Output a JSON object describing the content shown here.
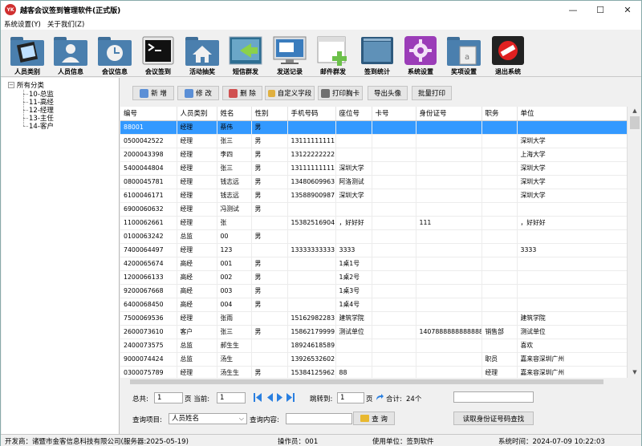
{
  "window": {
    "icon_text": "YK",
    "title": "越客会议签到管理软件(正式版)",
    "minimize": "—",
    "maximize": "☐",
    "close": "✕"
  },
  "menu": {
    "items": [
      "系统设置(Y)",
      "关于我们(Z)"
    ]
  },
  "toolbar": {
    "buttons": [
      "人员类别",
      "人员信息",
      "会议信息",
      "会议签到",
      "活动抽奖",
      "短信群发",
      "发送记录",
      "邮件群发",
      "签到统计",
      "系统设置",
      "奖项设置",
      "退出系统"
    ]
  },
  "tree": {
    "root": "所有分类",
    "children": [
      "10-总监",
      "11-高经",
      "12-经理",
      "13-主任",
      "14-客户"
    ]
  },
  "actions": {
    "add": "新 增",
    "edit": "修 改",
    "delete": "删 除",
    "custom_field": "自定义字段",
    "print_card": "打印胸卡",
    "export_avatar": "导出头像",
    "batch_print": "批量打印"
  },
  "table": {
    "columns": [
      "编号",
      "人员类别",
      "姓名",
      "性别",
      "手机号码",
      "座位号",
      "卡号",
      "身份证号",
      "职务",
      "单位"
    ],
    "rows": [
      [
        "88001",
        "经理",
        "蔡伟",
        "男",
        "",
        "",
        "",
        "",
        "",
        ""
      ],
      [
        "0500042522",
        "经理",
        "张三",
        "男",
        "13111111111",
        "",
        "",
        "",
        "",
        "深圳大学"
      ],
      [
        "2000043398",
        "经理",
        "李四",
        "男",
        "13122222222",
        "",
        "",
        "",
        "",
        "上海大学"
      ],
      [
        "5400044804",
        "经理",
        "张三",
        "男",
        "13111111111",
        "深圳大学",
        "",
        "",
        "",
        "深圳大学"
      ],
      [
        "0800045781",
        "经理",
        "钱志远",
        "男",
        "13480609963",
        "阿洛测试",
        "",
        "",
        "",
        "深圳大学"
      ],
      [
        "6100046171",
        "经理",
        "钱志远",
        "男",
        "13588900987",
        "深圳大学",
        "",
        "",
        "",
        "深圳大学"
      ],
      [
        "6900060632",
        "经理",
        "冯测试",
        "男",
        "",
        "",
        "",
        "",
        "",
        ""
      ],
      [
        "1100062661",
        "经理",
        "张",
        "",
        "15382516904",
        "，好好好",
        "",
        "111",
        "",
        "，好好好"
      ],
      [
        "0100063242",
        "总监",
        "00",
        "男",
        "",
        "",
        "",
        "",
        "",
        ""
      ],
      [
        "7400064497",
        "经理",
        "123",
        "",
        "13333333333",
        "3333",
        "",
        "",
        "",
        "3333"
      ],
      [
        "4200065674",
        "高经",
        "001",
        "男",
        "",
        "1桌1号",
        "",
        "",
        "",
        ""
      ],
      [
        "1200066133",
        "高经",
        "002",
        "男",
        "",
        "1桌2号",
        "",
        "",
        "",
        ""
      ],
      [
        "9200067668",
        "高经",
        "003",
        "男",
        "",
        "1桌3号",
        "",
        "",
        "",
        ""
      ],
      [
        "6400068450",
        "高经",
        "004",
        "男",
        "",
        "1桌4号",
        "",
        "",
        "",
        ""
      ],
      [
        "7500069536",
        "经理",
        "张雨",
        "",
        "15162982283",
        "建筑学院",
        "",
        "",
        "",
        "建筑学院"
      ],
      [
        "2600073610",
        "客户",
        "张三",
        "男",
        "15862179999",
        "测试单位",
        "",
        "14078888888888888",
        "销售部",
        "测试单位"
      ],
      [
        "2400073575",
        "总监",
        "郝生生",
        "",
        "18924618589",
        "",
        "",
        "",
        "",
        "喜欢"
      ],
      [
        "9000074424",
        "总监",
        "汤生",
        "",
        "13926532602",
        "",
        "",
        "",
        "职员",
        "嘉来容深圳广州"
      ],
      [
        "0300075789",
        "经理",
        "汤生生",
        "男",
        "15384125962",
        "88",
        "",
        "",
        "经理",
        "嘉来容深圳广州"
      ]
    ]
  },
  "pager": {
    "total_label": "总共:",
    "total_pages": "1",
    "page_unit": "页",
    "current_label": "页 当前:",
    "current_page": "1",
    "jump_label": "跳转到:",
    "jump_page": "1",
    "sum_label": "合计:",
    "sum_value": "24个",
    "query_item_label": "查询项目:",
    "query_item_value": "人员姓名",
    "query_content_label": "查询内容:",
    "query_button": "查 询",
    "id_card_button": "读取身份证号码查找"
  },
  "status": {
    "developer": "开发商：诸暨市金客信息科技有限公司(服务器:2025-05-19)",
    "operator": "操作员：001",
    "unit": "使用单位：签到软件",
    "time": "系统时间：2024-07-09 10:22:03"
  },
  "colors": {
    "selection": "#3399ff",
    "app_icon": "#d03030"
  }
}
